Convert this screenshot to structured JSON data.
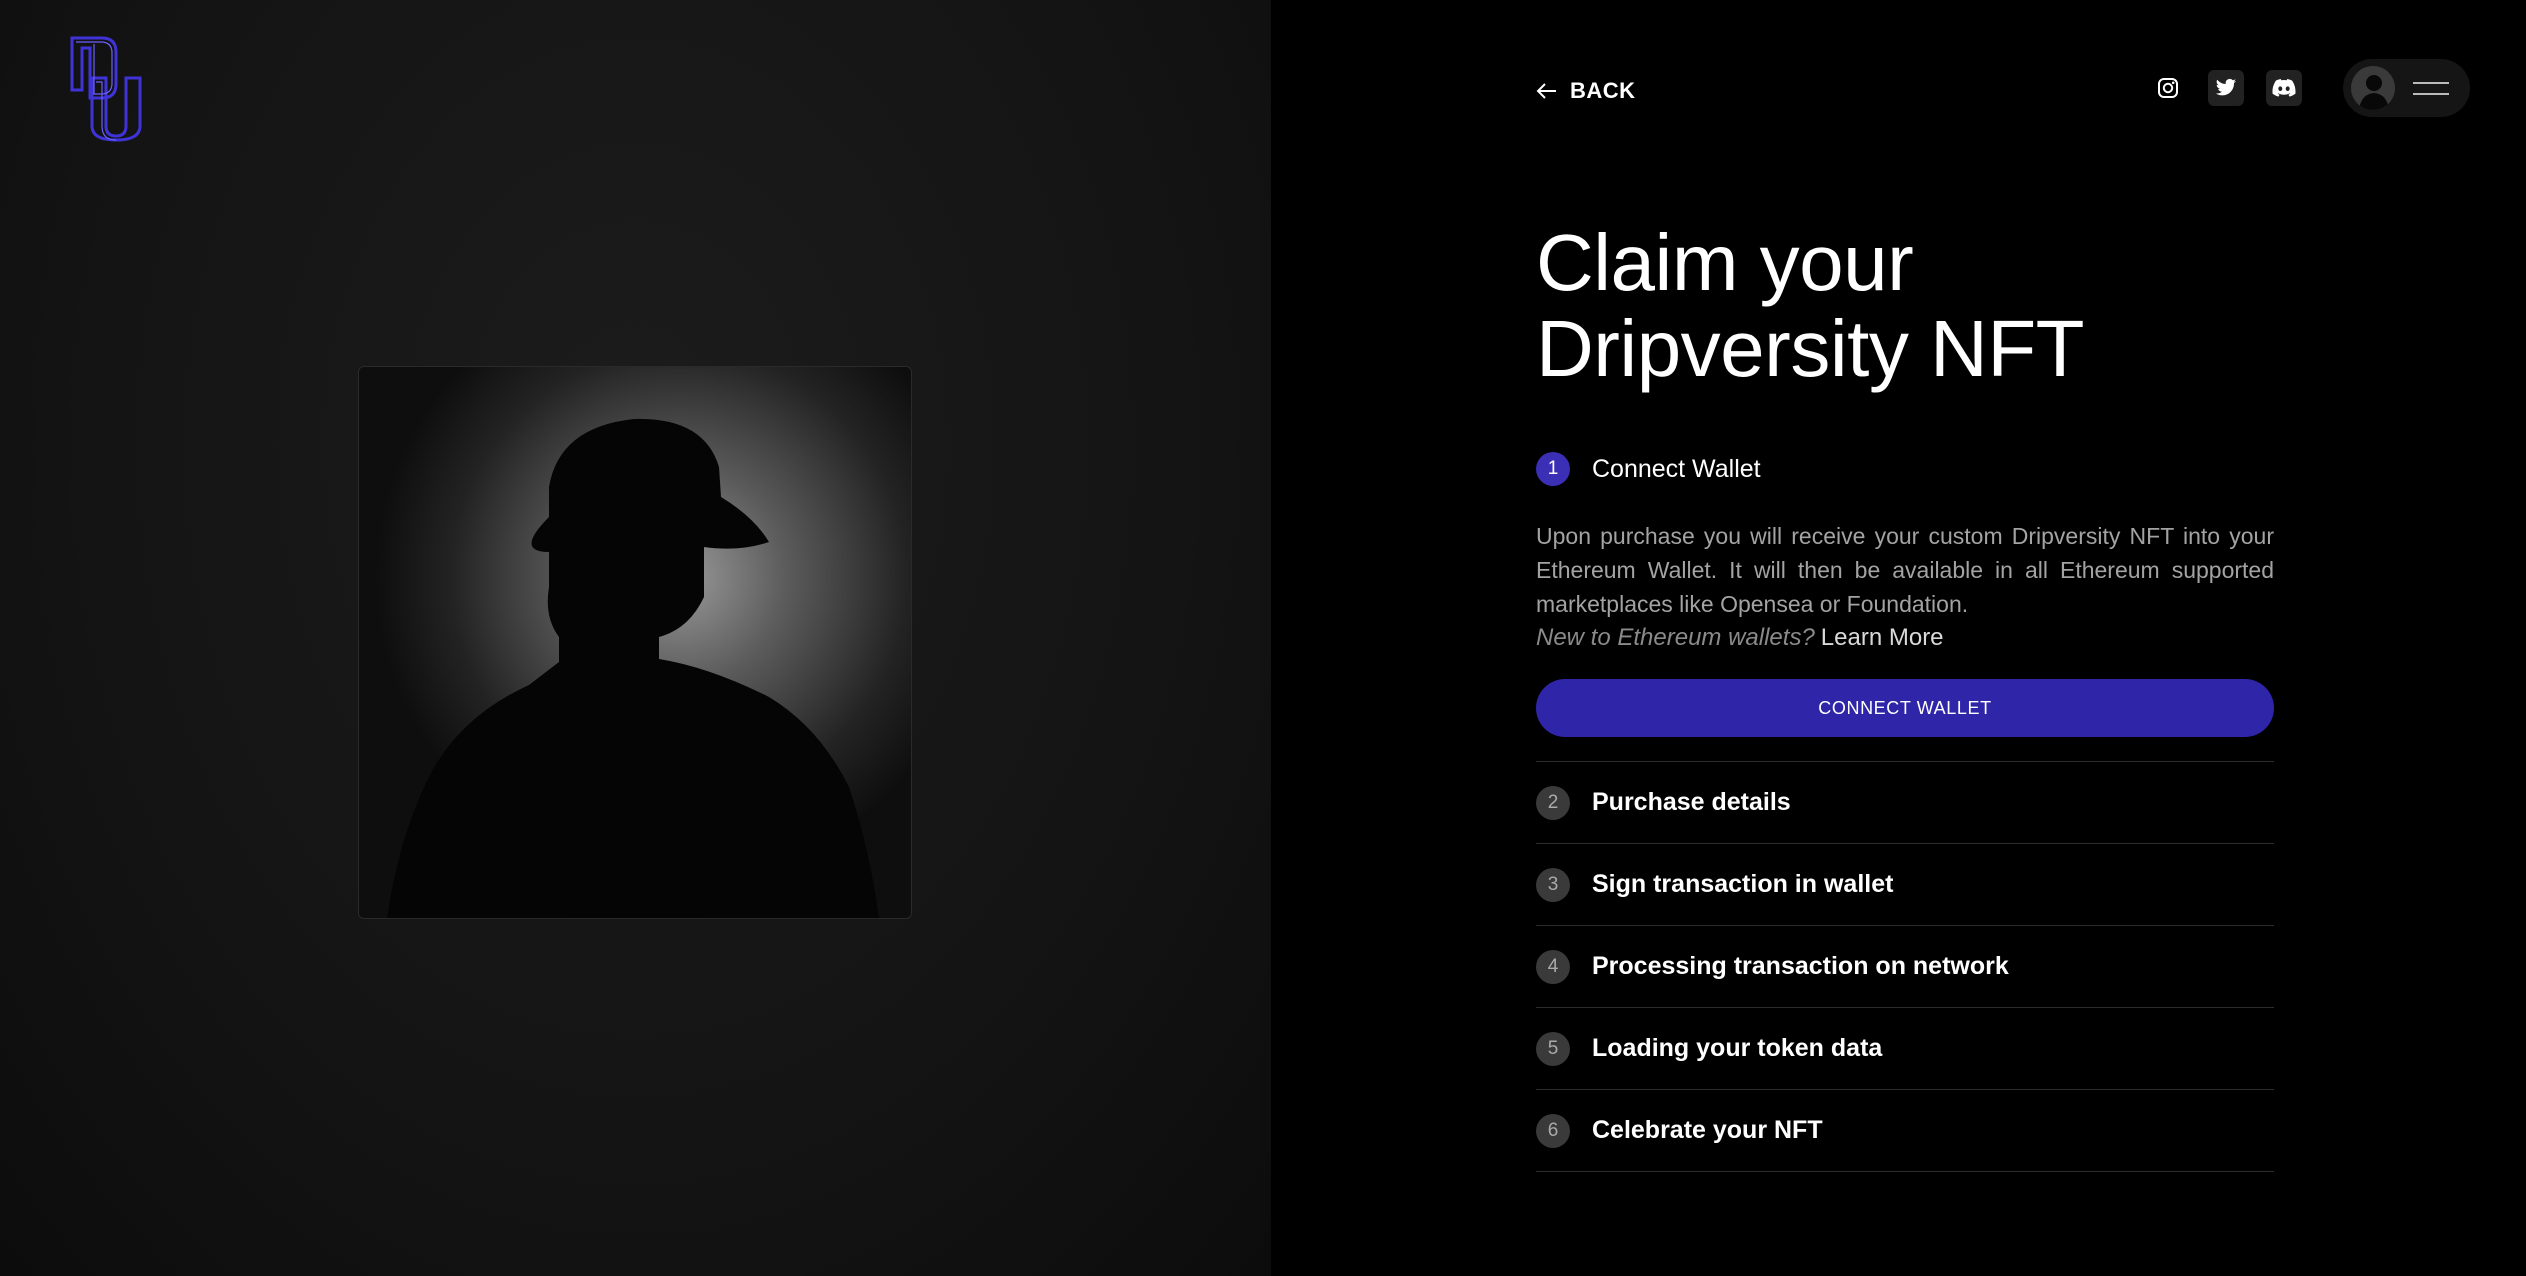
{
  "header": {
    "back_label": "BACK",
    "social_icons": [
      "instagram-icon",
      "twitter-icon",
      "discord-icon"
    ]
  },
  "main": {
    "title": "Claim your Dripversity NFT",
    "active_step": {
      "number": "1",
      "label": "Connect Wallet",
      "description": "Upon purchase you will receive your custom Dripversity NFT into your Ethereum Wallet. It will then be available in all Ethereum supported marketplaces like Opensea or Foundation.",
      "new_to_wallets": "New to Ethereum wallets?",
      "learn_more": "Learn More",
      "button_label": "CONNECT WALLET"
    },
    "steps": [
      {
        "number": "2",
        "label": "Purchase details"
      },
      {
        "number": "3",
        "label": "Sign transaction in wallet"
      },
      {
        "number": "4",
        "label": "Processing transaction on network"
      },
      {
        "number": "5",
        "label": "Loading your token data"
      },
      {
        "number": "6",
        "label": "Celebrate your NFT"
      }
    ]
  },
  "colors": {
    "accent": "#2e25a8",
    "logo": "#3a2fd0",
    "background": "#000000"
  }
}
